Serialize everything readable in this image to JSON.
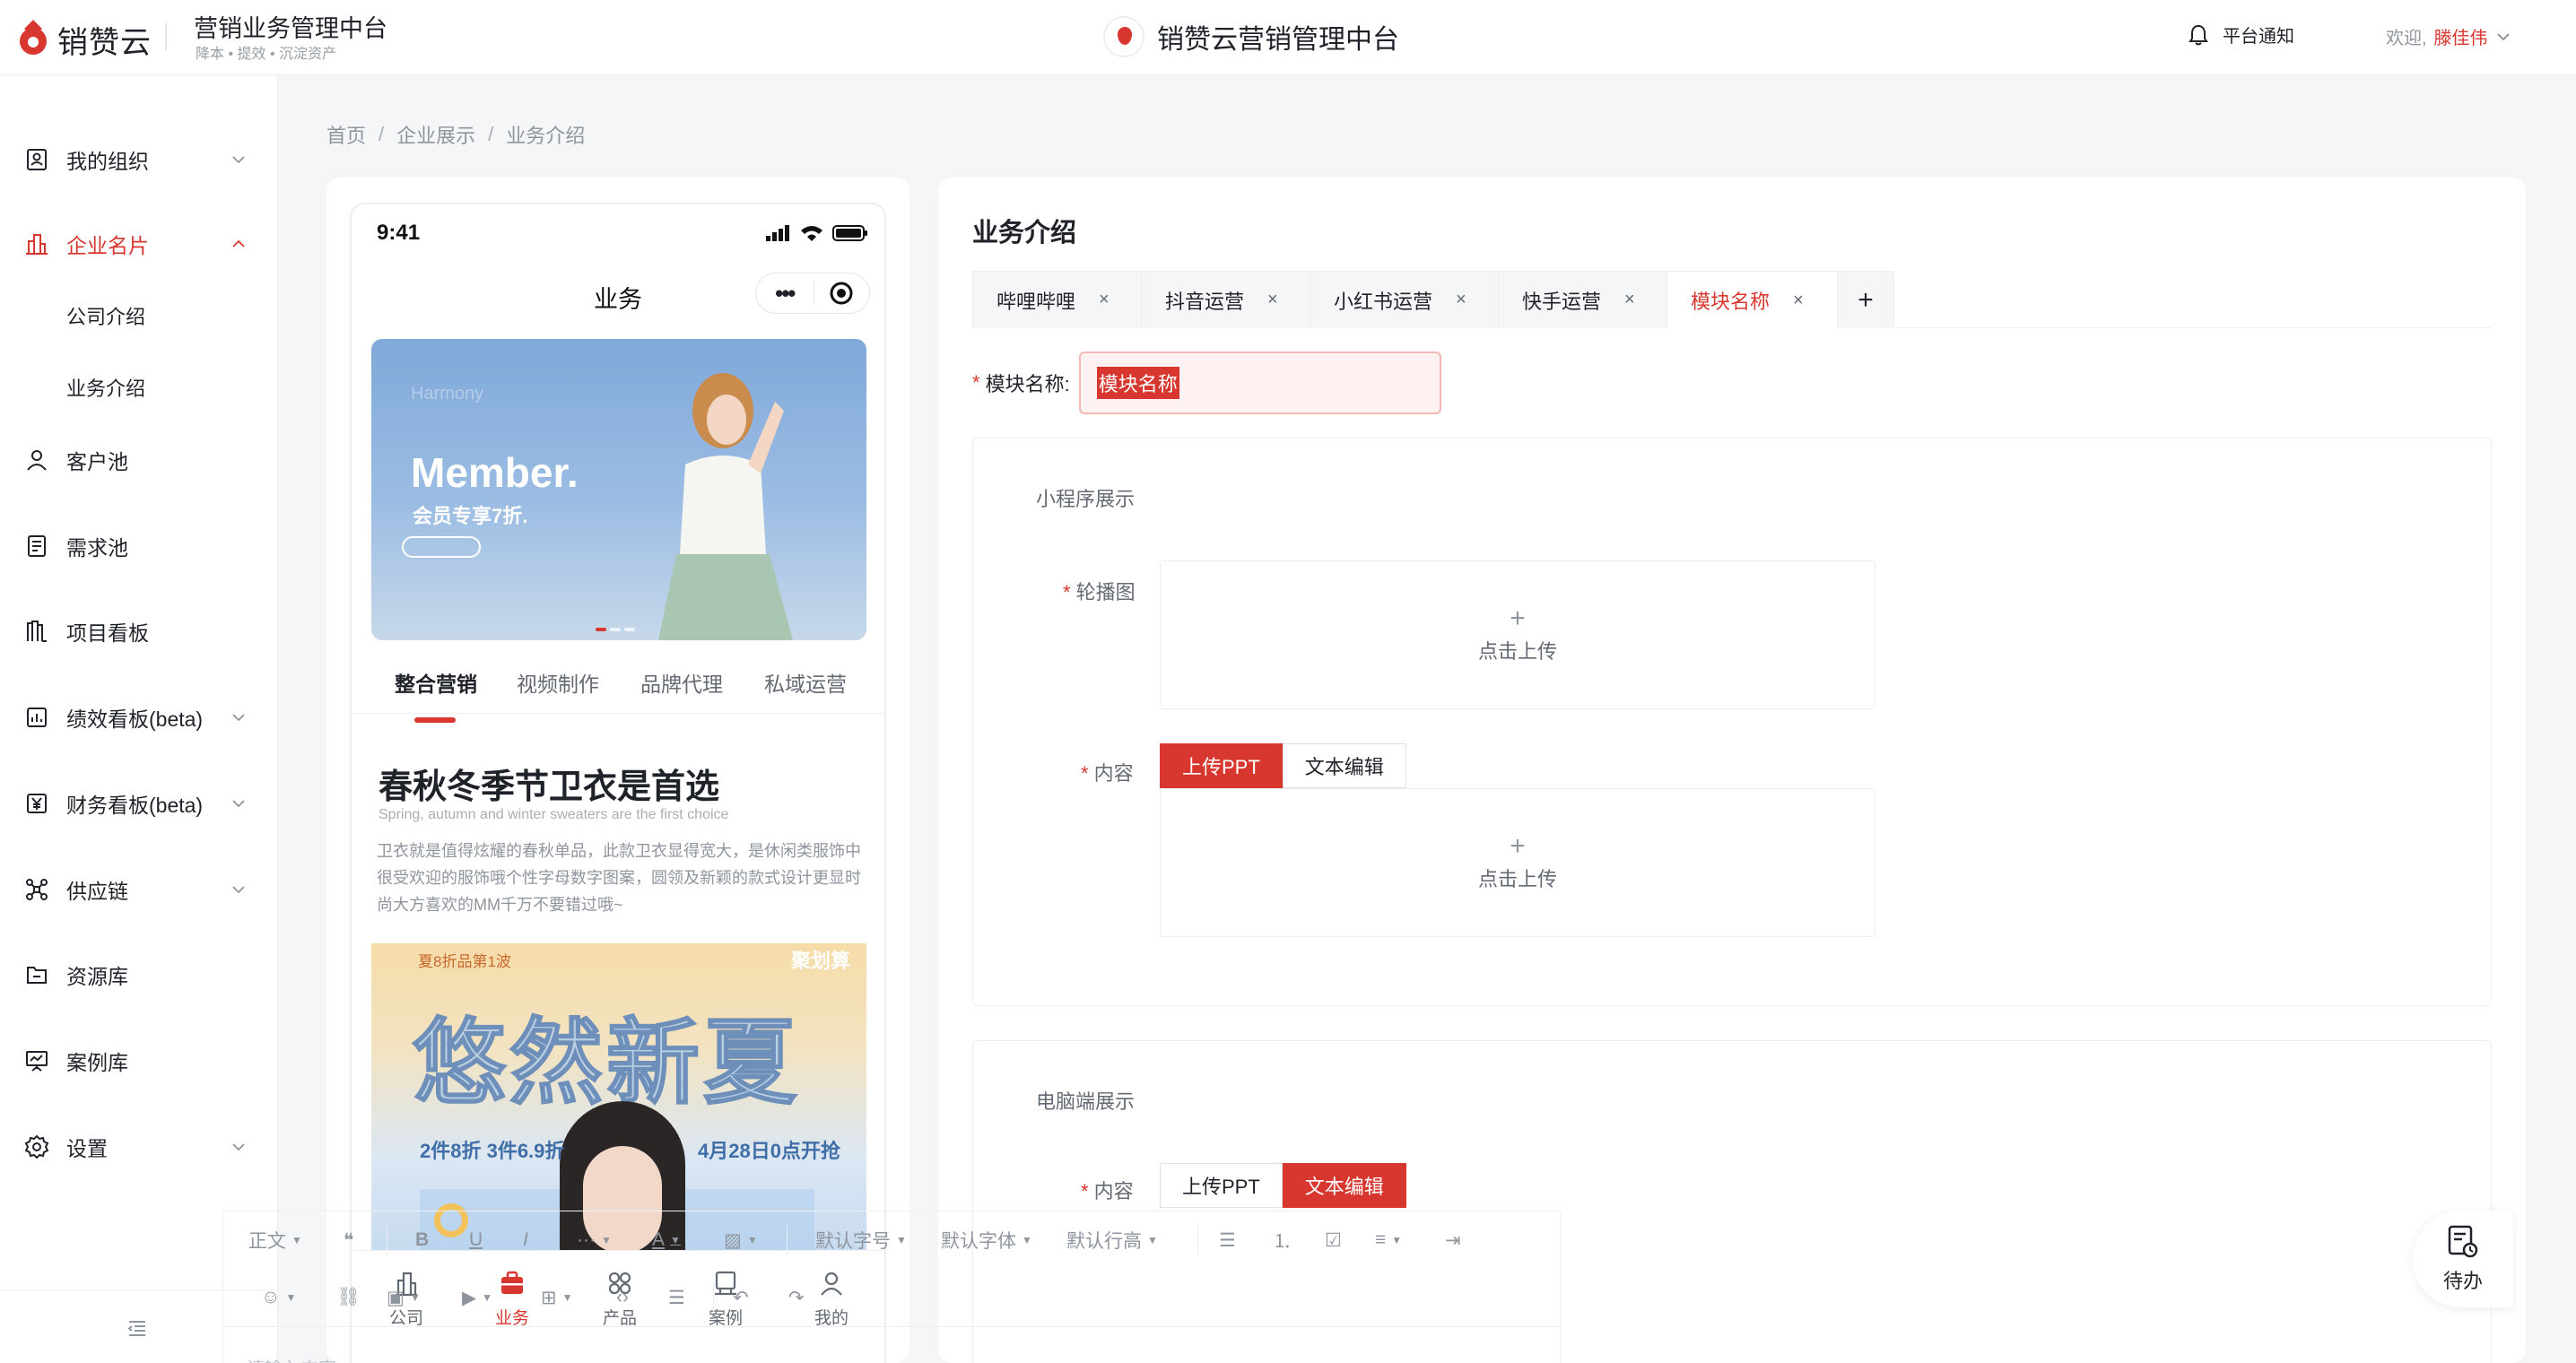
{
  "header": {
    "logo_text": "销赞云",
    "system_title": "营销业务管理中台",
    "system_subtitle": "降本 • 提效 • 沉淀资产",
    "center_brand": "销赞云营销管理中台",
    "notify_label": "平台通知",
    "welcome_prefix": "欢迎,",
    "user_name": "滕佳伟"
  },
  "sidebar": {
    "items": [
      {
        "label": "我的组织",
        "icon": "org-icon",
        "expand": "chevron-down-icon"
      },
      {
        "label": "企业名片",
        "icon": "building-icon",
        "expand": "chevron-up-icon",
        "active": true
      },
      {
        "label": "客户池",
        "icon": "user-icon"
      },
      {
        "label": "需求池",
        "icon": "document-icon"
      },
      {
        "label": "项目看板",
        "icon": "board-icon"
      },
      {
        "label": "绩效看板(beta)",
        "icon": "chart-icon",
        "expand": "chevron-down-icon"
      },
      {
        "label": "财务看板(beta)",
        "icon": "yen-icon",
        "expand": "chevron-down-icon"
      },
      {
        "label": "供应链",
        "icon": "network-icon",
        "expand": "chevron-down-icon"
      },
      {
        "label": "资源库",
        "icon": "folder-icon"
      },
      {
        "label": "案例库",
        "icon": "presentation-icon"
      },
      {
        "label": "设置",
        "icon": "gear-icon",
        "expand": "chevron-down-icon"
      }
    ],
    "sub_items": [
      "公司介绍",
      "业务介绍"
    ]
  },
  "breadcrumb": [
    "首页",
    "企业展示",
    "业务介绍"
  ],
  "phone": {
    "time": "9:41",
    "title": "业务",
    "capsule_dots": "•••",
    "banner": {
      "harmony": "Harmony",
      "member": "Member.",
      "member_sub": "会员专享7折."
    },
    "tabs": [
      "整合营销",
      "视频制作",
      "品牌代理",
      "私域运营"
    ],
    "article_title": "春秋冬季节卫衣是首选",
    "article_en": "Spring, autumn and winter sweaters are the first choice",
    "article_body": "卫衣就是值得炫耀的春秋单品，此款卫衣显得宽大，是休闲类服饰中很受欢迎的服饰哦个性字母数字图案，圆领及新颖的款式设计更显时尚大方喜欢的MM千万不要错过哦~",
    "poster": {
      "top_left": "夏8折品第1波",
      "top_right": "聚划算",
      "headline": "悠然新夏",
      "promo_left": "2件8折 3件6.9折",
      "promo_right": "4月28日0点开抢"
    },
    "tabbar": [
      {
        "label": "公司",
        "icon": "company-icon"
      },
      {
        "label": "业务",
        "icon": "briefcase-icon",
        "active": true
      },
      {
        "label": "产品",
        "icon": "grid-icon"
      },
      {
        "label": "案例",
        "icon": "case-icon"
      },
      {
        "label": "我的",
        "icon": "profile-icon"
      }
    ]
  },
  "panel": {
    "title": "业务介绍",
    "tabs": [
      {
        "label": "哔哩哔哩"
      },
      {
        "label": "抖音运营"
      },
      {
        "label": "小红书运营"
      },
      {
        "label": "快手运营"
      },
      {
        "label": "模块名称",
        "active": true
      }
    ],
    "close_glyph": "×",
    "add_glyph": "+",
    "module_name_label": "模块名称:",
    "module_name_value": "模块名称",
    "required_mark": "*",
    "mini_section": {
      "title": "小程序展示",
      "carousel_label": "轮播图",
      "content_label": "内容",
      "upload_text": "点击上传",
      "plus": "+",
      "seg": [
        "上传PPT",
        "文本编辑"
      ],
      "seg_active": 0
    },
    "pc_section": {
      "title": "电脑端展示",
      "content_label": "内容",
      "seg": [
        "上传PPT",
        "文本编辑"
      ],
      "seg_active": 1
    },
    "editor": {
      "paragraph": "正文",
      "font_size": "默认字号",
      "font_family": "默认字体",
      "line_height": "默认行高",
      "more": "···",
      "font_color": "A",
      "placeholder": "请输入内容"
    }
  },
  "todo_label": "待办",
  "colors": {
    "accent": "#d8372f",
    "text": "#1f2329",
    "muted": "#8f959e",
    "border": "#eceef1"
  }
}
